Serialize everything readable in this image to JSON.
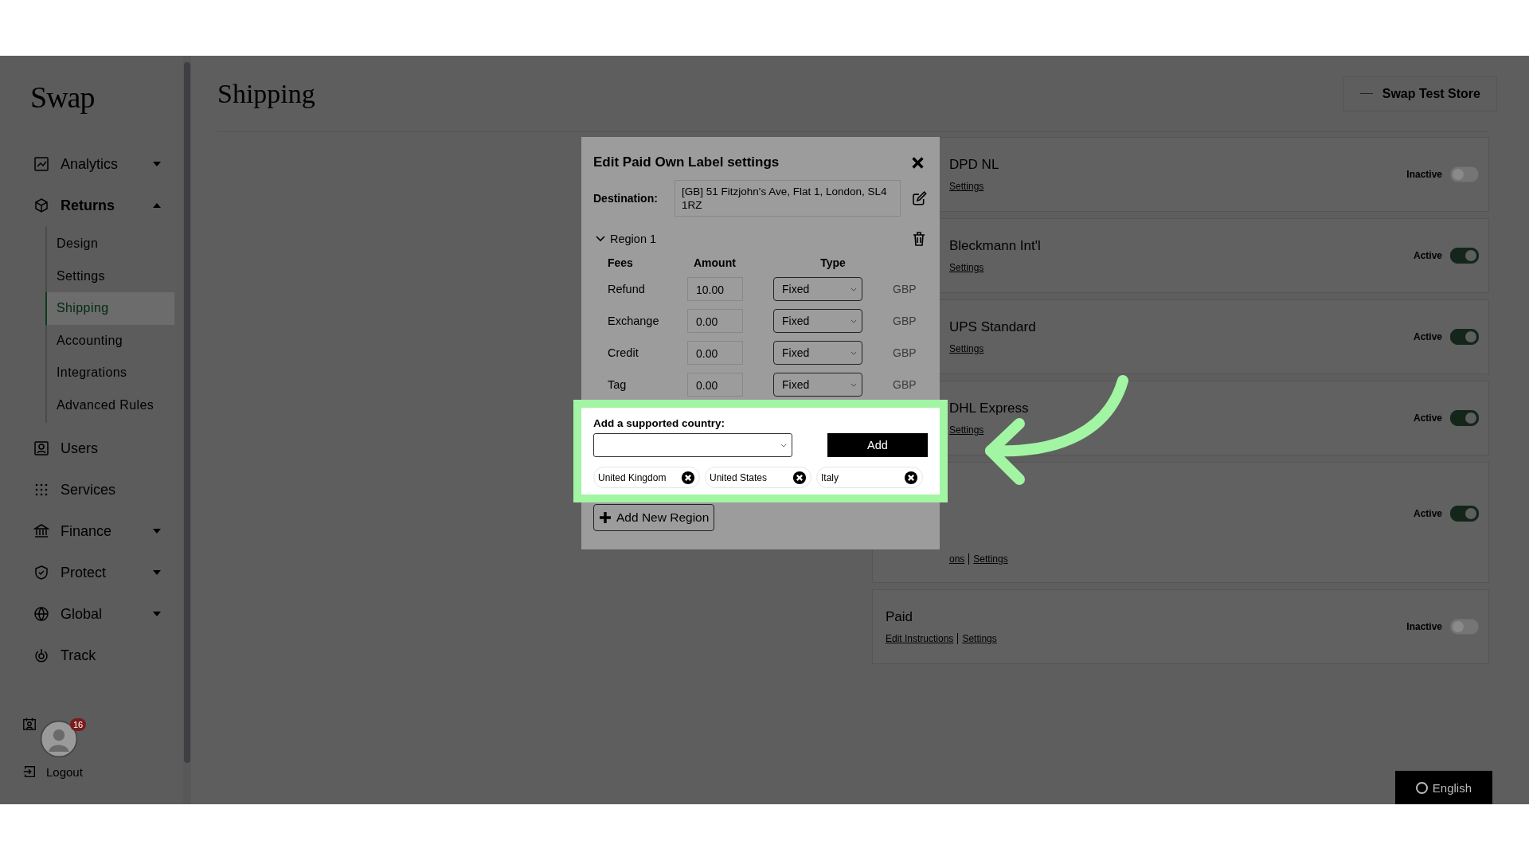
{
  "sidebar": {
    "logo": "Swap",
    "items": [
      {
        "label": "Analytics",
        "expanded": false,
        "selected": false
      },
      {
        "label": "Returns",
        "expanded": true,
        "selected": true,
        "children": [
          {
            "label": "Design",
            "selected": false
          },
          {
            "label": "Settings",
            "selected": false
          },
          {
            "label": "Shipping",
            "selected": true
          },
          {
            "label": "Accounting",
            "selected": false
          },
          {
            "label": "Integrations",
            "selected": false
          },
          {
            "label": "Advanced Rules",
            "selected": false
          }
        ]
      },
      {
        "label": "Users",
        "selected": false
      },
      {
        "label": "Services",
        "selected": false
      },
      {
        "label": "Finance",
        "expanded": false,
        "selected": false
      },
      {
        "label": "Protect",
        "expanded": false,
        "selected": false
      },
      {
        "label": "Global",
        "expanded": false,
        "selected": false
      },
      {
        "label": "Track",
        "selected": false
      }
    ],
    "logout": "Logout",
    "badge": "16"
  },
  "page": {
    "title": "Shipping",
    "store": "Swap Test Store",
    "language": "English"
  },
  "carriers": [
    {
      "kind": "named",
      "name": "DPD NL",
      "links": [
        "Settings"
      ],
      "status": "Inactive",
      "active": false
    },
    {
      "kind": "named",
      "name": "Bleckmann Int'l",
      "links": [
        "Settings"
      ],
      "status": "Active",
      "active": true
    },
    {
      "kind": "named",
      "name": "UPS Standard",
      "links": [
        "Settings"
      ],
      "status": "Active",
      "active": true
    },
    {
      "kind": "named",
      "name": "DHL Express",
      "links": [
        "Settings"
      ],
      "status": "Active",
      "active": true
    },
    {
      "kind": "covered",
      "links": [
        "ons",
        "Settings"
      ],
      "status": "Active",
      "active": true
    },
    {
      "kind": "plain",
      "name": "Paid",
      "links": [
        "Edit Instructions",
        "Settings"
      ],
      "status": "Inactive",
      "active": false
    }
  ],
  "modal": {
    "title": "Edit Paid Own Label settings",
    "destination_label": "Destination:",
    "destination": "[GB] 51 Fitzjohn's Ave, Flat 1, London, SL4 1RZ",
    "region": {
      "title": "Region 1",
      "expanded": true,
      "columns": [
        "Fees",
        "Amount",
        "Type"
      ],
      "fees": [
        {
          "name": "Refund",
          "amount": "10.00",
          "type": "Fixed",
          "currency": "GBP"
        },
        {
          "name": "Exchange",
          "amount": "0.00",
          "type": "Fixed",
          "currency": "GBP"
        },
        {
          "name": "Credit",
          "amount": "0.00",
          "type": "Fixed",
          "currency": "GBP"
        },
        {
          "name": "Tag",
          "amount": "0.00",
          "type": "Fixed",
          "currency": "GBP"
        }
      ]
    },
    "country_label": "Add a supported country:",
    "add_button": "Add",
    "countries": [
      "United Kingdom",
      "United States",
      "Italy"
    ],
    "add_region": "Add New Region"
  }
}
